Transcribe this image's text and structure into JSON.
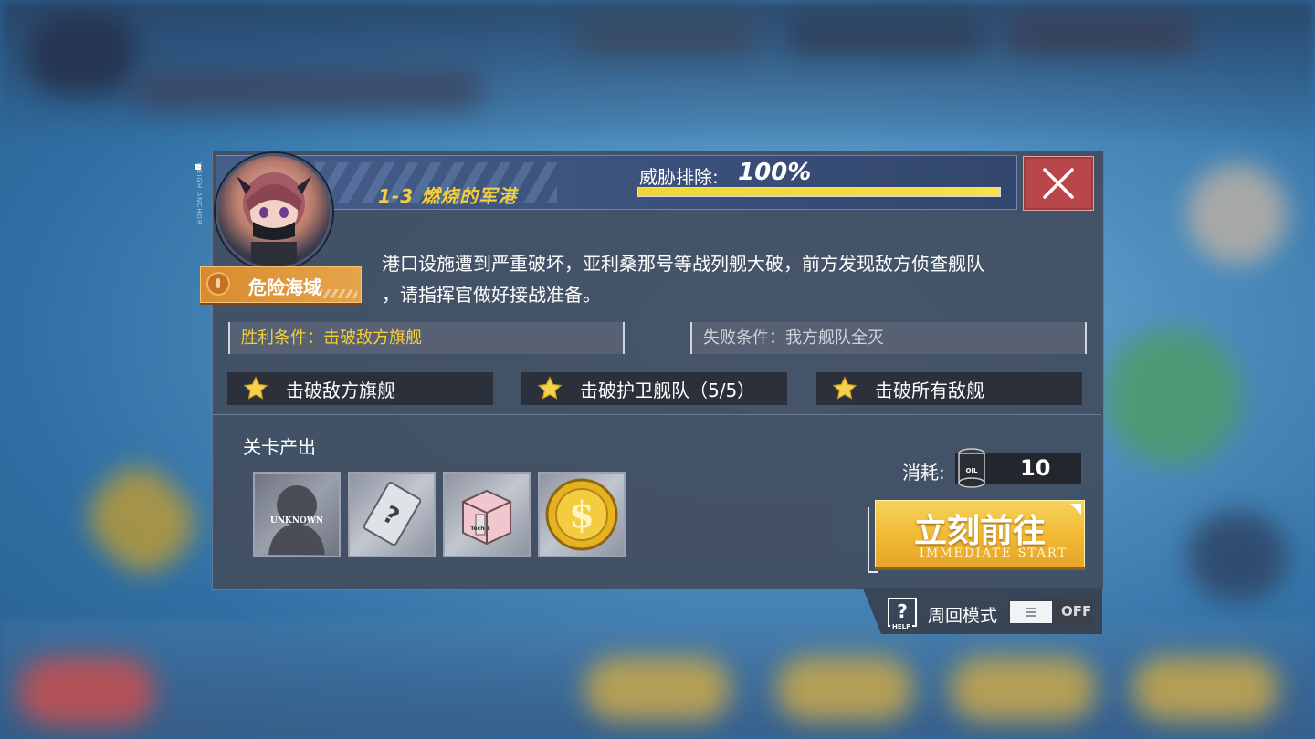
{
  "stage": {
    "title": "1-3 燃烧的军港",
    "threat_label": "威胁排除:",
    "threat_value": "100%",
    "threat_progress": 1.0,
    "side_tag": "WEIGH ANCHOR",
    "danger_label": "危险海域",
    "description_line1": "港口设施遭到严重破坏，亚利桑那号等战列舰大破，前方发现敌方侦查舰队",
    "description_line2": "，请指挥官做好接战准备。"
  },
  "conditions": {
    "victory": "胜利条件：击破敌方旗舰",
    "defeat": "失败条件：我方舰队全灭"
  },
  "objectives": [
    {
      "label": "击破敌方旗舰",
      "icon": "star-icon"
    },
    {
      "label": "击破护卫舰队（5/5）",
      "icon": "star-icon"
    },
    {
      "label": "击破所有敌舰",
      "icon": "star-icon"
    }
  ],
  "drops": {
    "title": "关卡产出",
    "items": [
      {
        "name": "unknown-ship",
        "label": "UNKNOWN"
      },
      {
        "name": "mystery-blueprint",
        "label": "?"
      },
      {
        "name": "tech-box",
        "label": "Tech 1"
      },
      {
        "name": "gold-coin",
        "label": ""
      }
    ]
  },
  "cost": {
    "label": "消耗:",
    "value": "10",
    "icon": "oil-barrel-icon",
    "icon_text": "OIL"
  },
  "start_button": {
    "label": "立刻前往",
    "sublabel": "IMMEDIATE START"
  },
  "loop_mode": {
    "help_text": "HELP",
    "label": "周回模式",
    "state": "OFF"
  },
  "colors": {
    "accent_yellow": "#f3cf3c",
    "close_red": "#b9464a",
    "danger_orange": "#d88a2e"
  }
}
